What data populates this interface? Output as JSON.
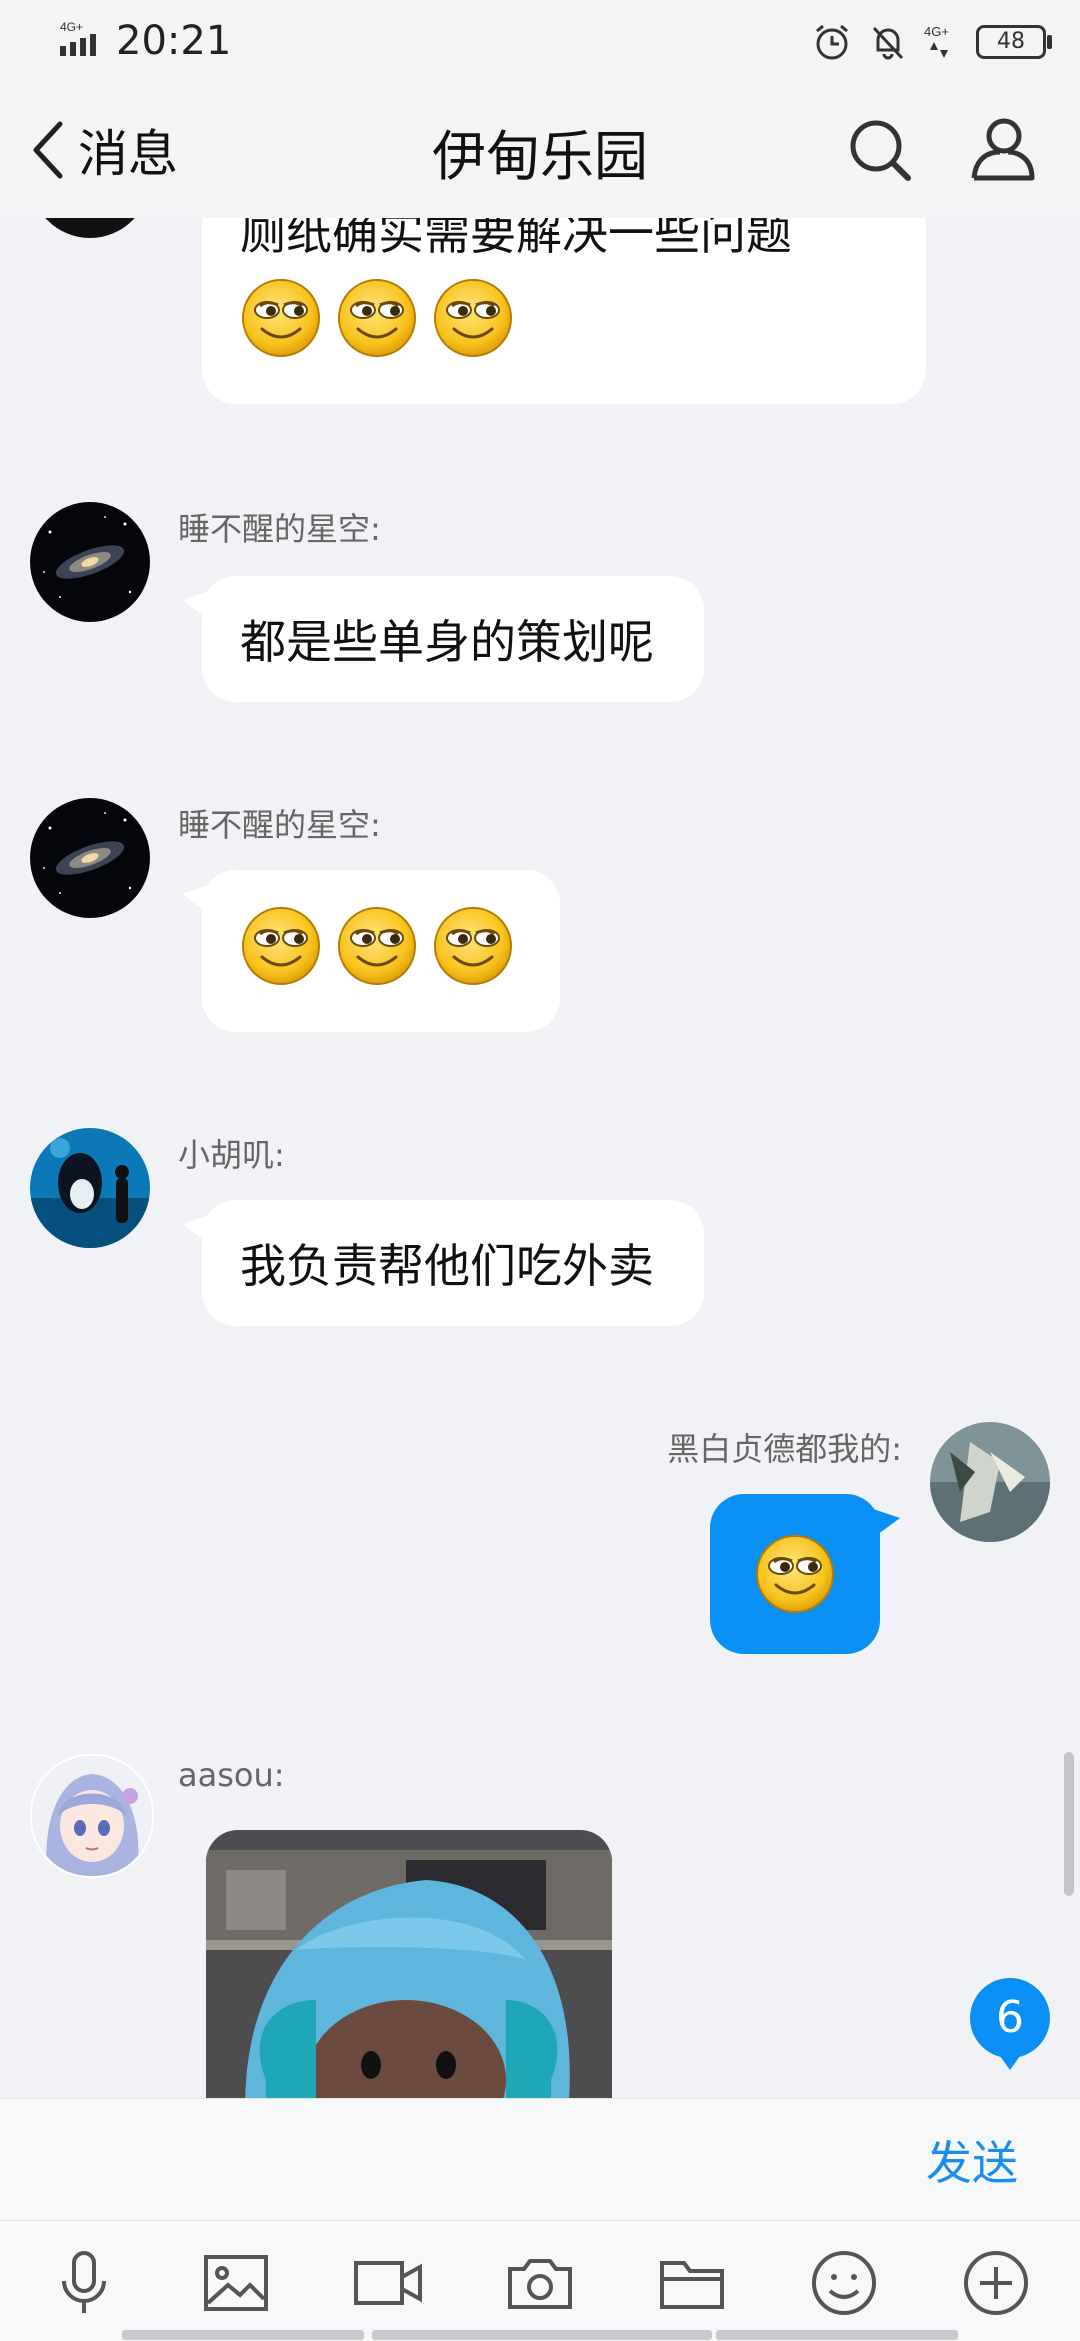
{
  "status_bar": {
    "time": "20:21",
    "network_left": "4G+",
    "network_right": "4G+",
    "battery": "48",
    "icons": [
      "signal-icon",
      "alarm-icon",
      "mute-bell-icon",
      "battery-icon"
    ]
  },
  "nav": {
    "back_label": "消息",
    "title": "伊甸乐园",
    "icons": [
      "chevron-left-icon",
      "search-icon",
      "group-members-icon"
    ]
  },
  "messages": [
    {
      "sender": "",
      "text": "厕纸确实需要解决一些问题",
      "emoji_count": 3,
      "emoji": "sly-smile-emoji"
    },
    {
      "sender": "睡不醒的星空:",
      "text": "都是些单身的策划呢",
      "avatar": "galaxy-avatar"
    },
    {
      "sender": "睡不醒的星空:",
      "text": "",
      "emoji_count": 3,
      "emoji": "sly-smile-emoji",
      "avatar": "galaxy-avatar"
    },
    {
      "sender": "小胡叽:",
      "text": "我负责帮他们吃外卖",
      "avatar": "orca-avatar"
    },
    {
      "sender": "黑白贞德都我的:",
      "text": "",
      "emoji_count": 1,
      "emoji": "sly-smile-emoji",
      "avatar": "armored-figure-avatar",
      "mine": true
    },
    {
      "sender": "aasou:",
      "text": "",
      "image": "blue-hat-plush-photo",
      "avatar": "anime-girl-avatar"
    }
  ],
  "unread_badge": "6",
  "input": {
    "send_label": "发送"
  },
  "toolbar": {
    "icons": [
      "microphone-icon",
      "image-icon",
      "video-icon",
      "camera-icon",
      "folder-icon",
      "smiley-icon",
      "plus-icon"
    ]
  },
  "colors": {
    "accent": "#0a8ff4",
    "background": "#f1f2f5",
    "bubble": "#ffffff"
  }
}
